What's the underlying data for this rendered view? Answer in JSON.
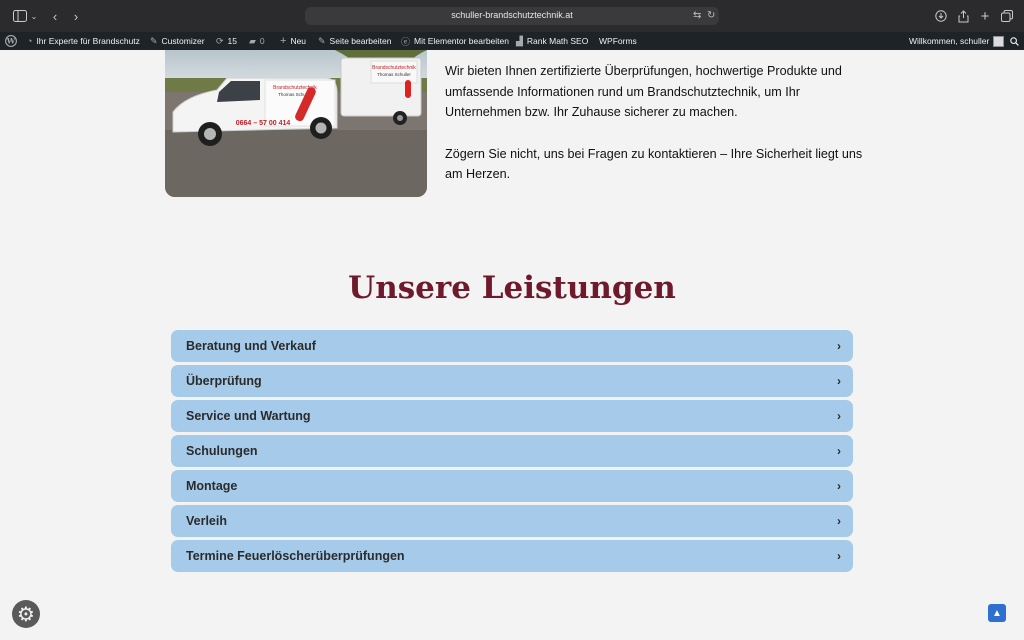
{
  "browser": {
    "url": "schuller-brandschutztechnik.at"
  },
  "admin_bar": {
    "site_name": "Ihr Experte für Brandschutz",
    "customizer": "Customizer",
    "updates_count": "15",
    "comments_count": "0",
    "new": "Neu",
    "edit_page": "Seite bearbeiten",
    "elementor": "Mit Elementor bearbeiten",
    "rank_math": "Rank Math SEO",
    "wpforms": "WPForms",
    "greeting": "Willkommen, schuller"
  },
  "hero_image": {
    "van_title": "Brandschutztechnik",
    "van_name": "Thomas Schuller",
    "van_phone": "0664 – 57 00 414",
    "trailer_title": "Brandschutztechnik",
    "trailer_name": "Thomas Schuller"
  },
  "intro": {
    "paragraph1": "Wir bieten Ihnen zertifizierte Überprüfungen, hochwertige Produkte und umfassende Informationen rund um Brandschutztechnik, um Ihr Unternehmen bzw. Ihr Zuhause sicherer zu machen.",
    "paragraph2": "Zögern Sie nicht, uns bei Fragen zu kontaktieren – Ihre Sicherheit liegt uns am Herzen."
  },
  "services": {
    "title": "Unsere Leistungen",
    "items": [
      {
        "label": "Beratung und Verkauf"
      },
      {
        "label": "Überprüfung"
      },
      {
        "label": "Service und Wartung"
      },
      {
        "label": "Schulungen"
      },
      {
        "label": "Montage"
      },
      {
        "label": "Verleih"
      },
      {
        "label": "Termine Feuerlöscherüberprüfungen"
      }
    ]
  },
  "colors": {
    "accent_title": "#6f1a2c",
    "accordion_bg": "#a6cbea",
    "admin_bar": "#1d2327",
    "scroll_top": "#2f6fd0"
  },
  "icons": {
    "accordion": "chevron-right-icon",
    "cookie": "gear-icon",
    "scroll_top": "chevron-up-icon"
  }
}
